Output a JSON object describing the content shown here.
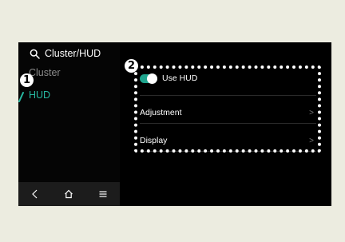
{
  "header": {
    "title": "Cluster/HUD",
    "search_icon": "search-icon"
  },
  "sidebar": {
    "items": [
      {
        "label": "Cluster",
        "active": false
      },
      {
        "label": "HUD",
        "active": true
      }
    ],
    "active_color": "#27b8a1"
  },
  "markers": {
    "one": "1",
    "two": "2"
  },
  "settings": {
    "use_hud": {
      "label": "Use HUD",
      "enabled": true,
      "toggle_color": "#1fa58e"
    },
    "adjustment": {
      "label": "Adjustment"
    },
    "display": {
      "label": "Display"
    }
  },
  "bottom_nav": {
    "icons": [
      "back-icon",
      "home-icon",
      "menu-icon"
    ]
  }
}
